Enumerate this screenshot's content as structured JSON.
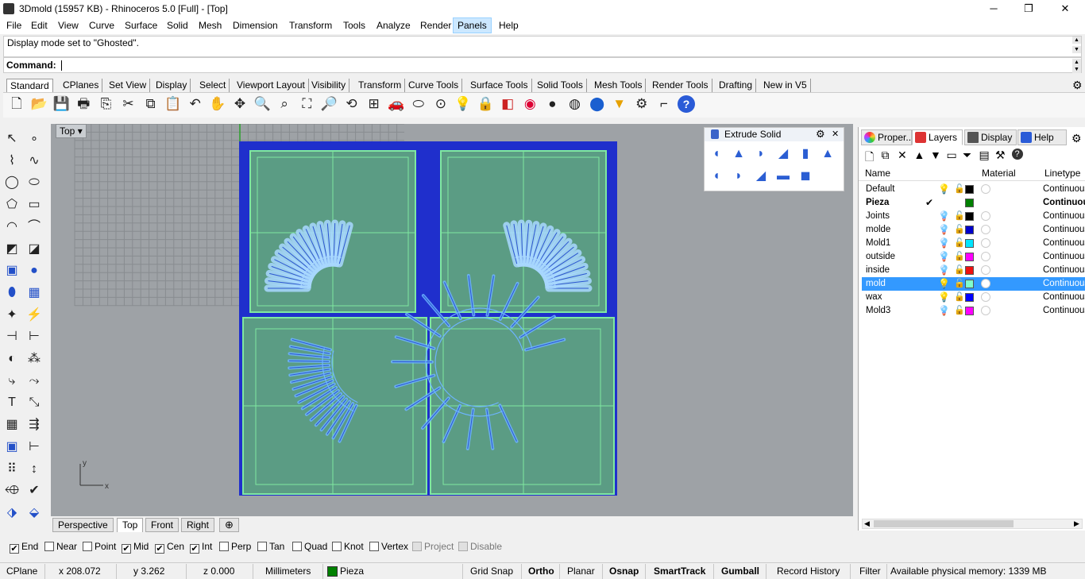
{
  "window": {
    "title": "3Dmold (15957 KB) - Rhinoceros 5.0 [Full] - [Top]",
    "minimize": "─",
    "restore": "❐",
    "close": "✕"
  },
  "menu": [
    "File",
    "Edit",
    "View",
    "Curve",
    "Surface",
    "Solid",
    "Mesh",
    "Dimension",
    "Transform",
    "Tools",
    "Analyze",
    "Render",
    "Panels",
    "Help"
  ],
  "command": {
    "history": "Display mode set to \"Ghosted\".",
    "label": "Command:"
  },
  "toolbar_tabs": [
    "Standard",
    "CPlanes",
    "Set View",
    "Display",
    "Select",
    "Viewport Layout",
    "Visibility",
    "Transform",
    "Curve Tools",
    "Surface Tools",
    "Solid Tools",
    "Mesh Tools",
    "Render Tools",
    "Drafting",
    "New in V5"
  ],
  "toolbar_icons": [
    "new-icon",
    "open-icon",
    "save-icon",
    "print-icon",
    "import-icon",
    "cut-icon",
    "copy-icon",
    "paste-icon",
    "undo-icon",
    "pan-icon",
    "move-view-icon",
    "zoom-icon",
    "zoom-window-icon",
    "zoom-extents-icon",
    "zoom-selected-icon",
    "rotate-view-icon",
    "four-viewports-icon",
    "car-icon",
    "rubber-icon",
    "snap-icon",
    "light-bulb-icon",
    "lock-icon",
    "paint-bucket-icon",
    "color-wheel-icon",
    "sphere-shaded-icon",
    "sphere-rendered-icon",
    "sphere-render-icon",
    "highlighter-icon",
    "gear-settings-icon",
    "dimension-icon",
    "help-icon"
  ],
  "viewport": {
    "label": "Top",
    "axis_x": "x",
    "axis_y": "y"
  },
  "view_tabs": [
    "Perspective",
    "Top",
    "Front",
    "Right"
  ],
  "extrude_panel": {
    "title": "Extrude Solid"
  },
  "right_panel": {
    "tabs": [
      "Proper...",
      "Layers",
      "Display",
      "Help"
    ],
    "columns": {
      "name": "Name",
      "material": "Material",
      "linetype": "Linetype"
    },
    "layers": [
      {
        "name": "Default",
        "color": "#000000",
        "linetype": "Continuous",
        "current": false,
        "selected": false,
        "bulb": "on"
      },
      {
        "name": "Pieza",
        "color": "#008000",
        "linetype": "Continuous",
        "current": true,
        "selected": false,
        "bulb": ""
      },
      {
        "name": "Joints",
        "color": "#000000",
        "linetype": "Continuous",
        "current": false,
        "selected": false,
        "bulb": "blue"
      },
      {
        "name": "molde",
        "color": "#0000cc",
        "linetype": "Continuous",
        "current": false,
        "selected": false,
        "bulb": "blue"
      },
      {
        "name": "Mold1",
        "color": "#00e5ff",
        "linetype": "Continuous",
        "current": false,
        "selected": false,
        "bulb": "blue"
      },
      {
        "name": "outside",
        "color": "#ff00ff",
        "linetype": "Continuous",
        "current": false,
        "selected": false,
        "bulb": "blue"
      },
      {
        "name": "inside",
        "color": "#ee1111",
        "linetype": "Continuous",
        "current": false,
        "selected": false,
        "bulb": "blue"
      },
      {
        "name": "mold",
        "color": "#80ffcc",
        "linetype": "Continuous",
        "current": false,
        "selected": true,
        "bulb": "on"
      },
      {
        "name": "wax",
        "color": "#0000ff",
        "linetype": "Continuous",
        "current": false,
        "selected": false,
        "bulb": "on"
      },
      {
        "name": "Mold3",
        "color": "#ff00ff",
        "linetype": "Continuous",
        "current": false,
        "selected": false,
        "bulb": "blue"
      }
    ]
  },
  "osnaps": [
    {
      "label": "End",
      "checked": true
    },
    {
      "label": "Near",
      "checked": false
    },
    {
      "label": "Point",
      "checked": false
    },
    {
      "label": "Mid",
      "checked": true
    },
    {
      "label": "Cen",
      "checked": true
    },
    {
      "label": "Int",
      "checked": true
    },
    {
      "label": "Perp",
      "checked": false
    },
    {
      "label": "Tan",
      "checked": false
    },
    {
      "label": "Quad",
      "checked": false
    },
    {
      "label": "Knot",
      "checked": false
    },
    {
      "label": "Vertex",
      "checked": false
    },
    {
      "label": "Project",
      "checked": false,
      "disabled": true
    },
    {
      "label": "Disable",
      "checked": false,
      "disabled": true
    }
  ],
  "status": {
    "cplane": "CPlane",
    "x": "x 208.072",
    "y": "y 3.262",
    "z": "z 0.000",
    "units": "Millimeters",
    "layer": "Pieza",
    "layer_color": "#008000",
    "grid_snap": "Grid Snap",
    "ortho": "Ortho",
    "planar": "Planar",
    "osnap": "Osnap",
    "smarttrack": "SmartTrack",
    "gumball": "Gumball",
    "record_history": "Record History",
    "filter": "Filter",
    "memory": "Available physical memory: 1339 MB"
  }
}
